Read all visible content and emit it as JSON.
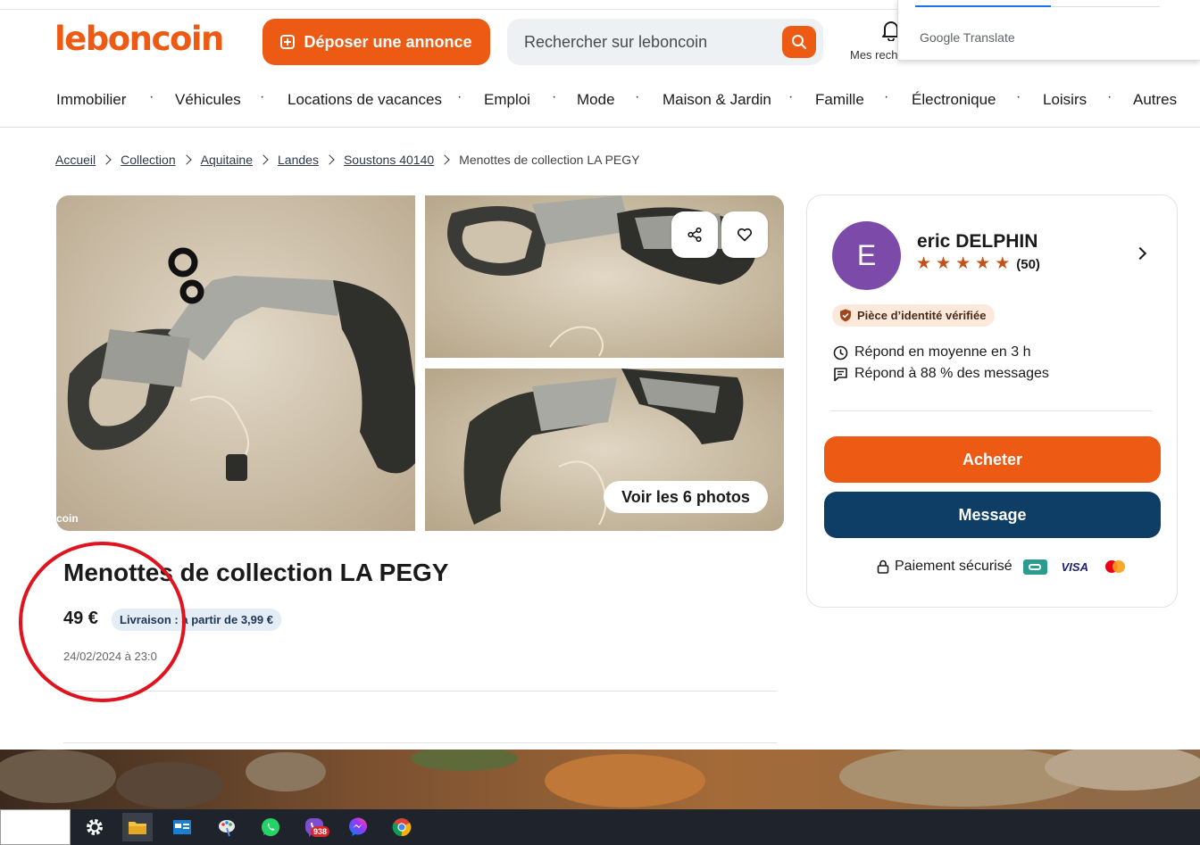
{
  "header": {
    "logo": "leboncoin",
    "deposit_label": "Déposer une annonce",
    "search_placeholder": "Rechercher sur leboncoin",
    "my_searches": "Mes rech"
  },
  "translate_popup": {
    "label": "Google Translate"
  },
  "categories": [
    "Immobilier",
    "Véhicules",
    "Locations de vacances",
    "Emploi",
    "Mode",
    "Maison & Jardin",
    "Famille",
    "Électronique",
    "Loisirs",
    "Autres"
  ],
  "breadcrumb": {
    "items": [
      "Accueil",
      "Collection",
      "Aquitaine",
      "Landes",
      "Soustons 40140"
    ],
    "current": "Menottes de collection LA PEGY"
  },
  "gallery": {
    "watermark": "coin",
    "see_photos": "Voir les 6 photos"
  },
  "listing": {
    "title": "Menottes de collection LA PEGY",
    "price": "49 €",
    "delivery": "Livraison : à partir de 3,99 €",
    "date": "24/02/2024 à 23:0"
  },
  "seller": {
    "initial": "E",
    "name": "eric DELPHIN",
    "rating": 5,
    "reviews": "(50)",
    "id_badge": "Pièce d’identité vérifiée",
    "response_time": "Répond en moyenne en 3 h",
    "response_rate": "Répond à 88 % des messages"
  },
  "actions": {
    "buy": "Acheter",
    "message": "Message",
    "secure_payment": "Paiement sécurisé",
    "visa": "VISA"
  },
  "taskbar": {
    "messenger_badge": "938"
  },
  "colors": {
    "brand": "#ec5a13",
    "message_button": "#0e3d66",
    "avatar": "#7c4aa8",
    "annotation_circle": "#e0141e"
  }
}
